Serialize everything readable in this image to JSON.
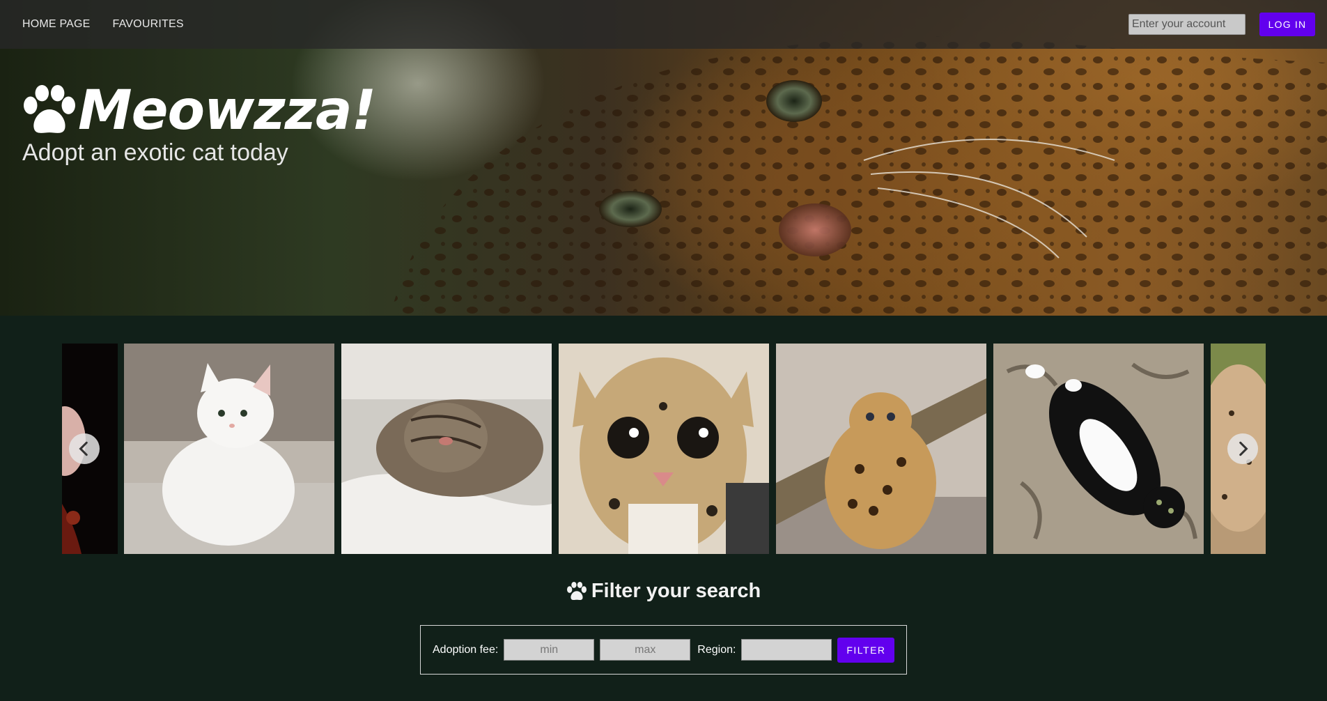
{
  "nav": {
    "home_label": "HOME PAGE",
    "favourites_label": "FAVOURITES",
    "account_placeholder": "Enter your account",
    "login_label": "LOG IN"
  },
  "hero": {
    "title": "Meowzza!",
    "subtitle": "Adopt an exotic cat today",
    "image": "leopard-photo"
  },
  "carousel": {
    "slides": [
      {
        "name": "partial-dark-cat-photo",
        "colors": [
          "#0a0505",
          "#5a1a10"
        ]
      },
      {
        "name": "white-fluffy-cat-photo",
        "colors": [
          "#e9e6e1",
          "#9c958c"
        ]
      },
      {
        "name": "tabby-cat-sleeping-photo",
        "colors": [
          "#d8d6d2",
          "#6a5e50"
        ]
      },
      {
        "name": "ocelot-kitten-photo",
        "colors": [
          "#c9b28a",
          "#3b2e22"
        ]
      },
      {
        "name": "jaguar-cub-on-branch-photo",
        "colors": [
          "#bfb4a6",
          "#8a6a3a"
        ]
      },
      {
        "name": "black-white-cat-on-rug-photo",
        "colors": [
          "#a99e8c",
          "#1a1a1a"
        ]
      },
      {
        "name": "partial-cheetah-photo",
        "colors": [
          "#c6a37a",
          "#6c5a3a"
        ]
      }
    ],
    "prev_icon": "chevron-left-icon",
    "next_icon": "chevron-right-icon"
  },
  "filter": {
    "heading": "Filter your search",
    "fee_label": "Adoption fee:",
    "min_placeholder": "min",
    "max_placeholder": "max",
    "region_label": "Region:",
    "region_value": "",
    "button_label": "FILTER"
  },
  "colors": {
    "accent": "#6200ee",
    "background": "#112019"
  }
}
